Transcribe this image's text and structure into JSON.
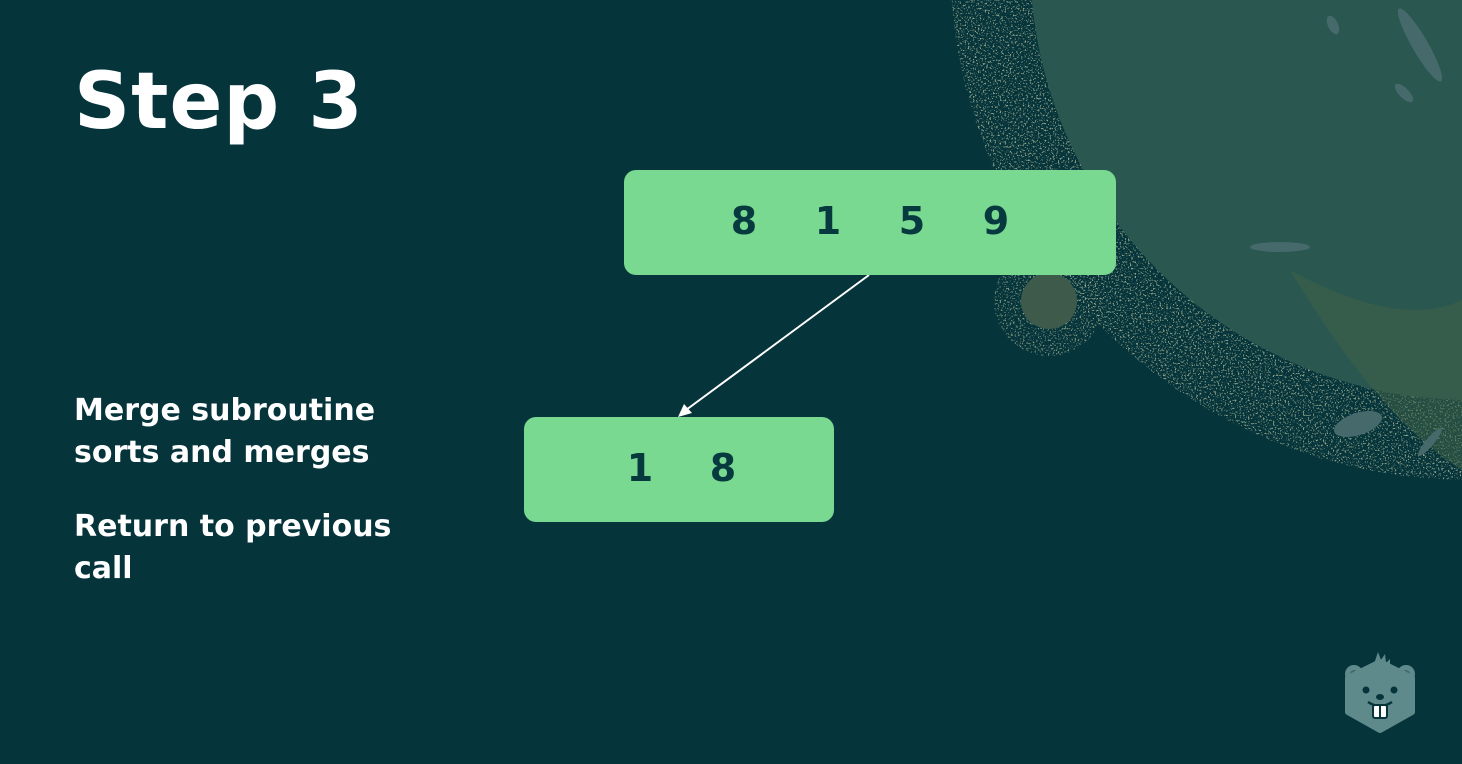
{
  "slide": {
    "title": "Step 3",
    "descriptions": [
      "Merge subroutine sorts and merges",
      "Return to previous call"
    ]
  },
  "diagram": {
    "parent_array": [
      "8",
      "1",
      "5",
      "9"
    ],
    "child_array": [
      "1",
      "8"
    ],
    "edge": "parent-to-left-child"
  },
  "colors": {
    "background": "#05343b",
    "box_fill": "#79d991",
    "box_text": "#073a3e",
    "text": "#ffffff",
    "logo": "#5e8a8c"
  },
  "logo": {
    "icon": "beaver-mascot-icon"
  }
}
